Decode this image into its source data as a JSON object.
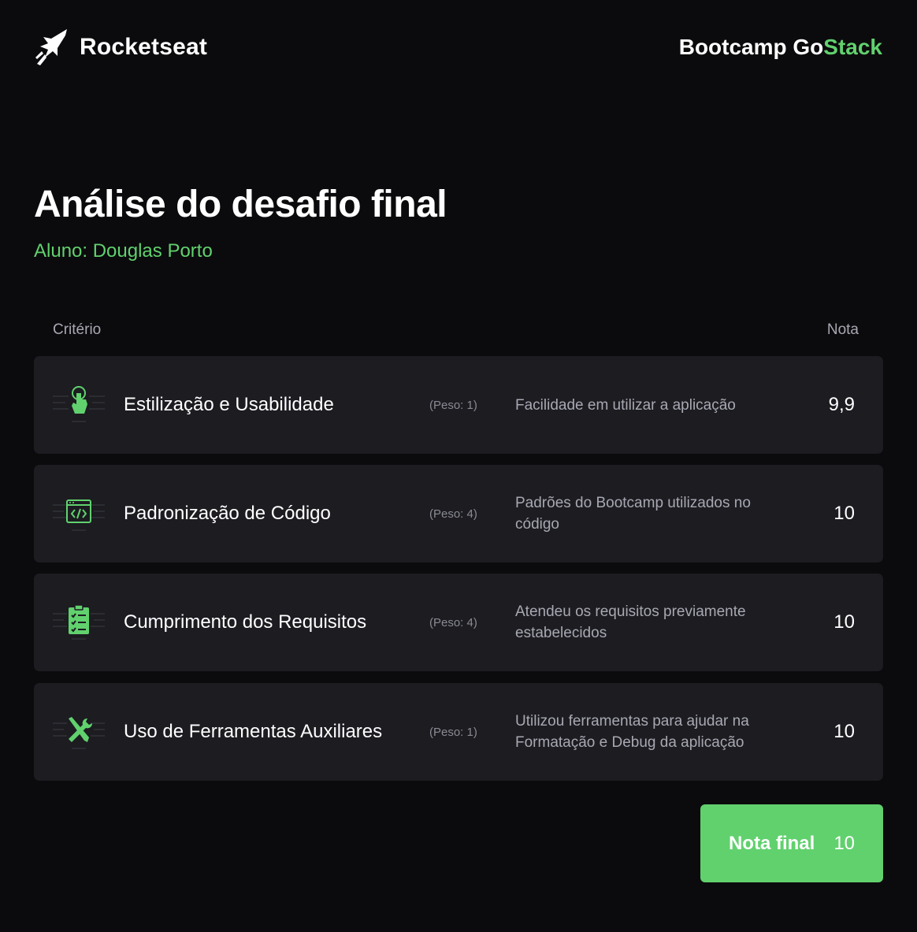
{
  "header": {
    "brand_name": "Rocketseat",
    "bootcamp_prefix": "Bootcamp Go",
    "bootcamp_accent": "Stack"
  },
  "title": "Análise do desafio final",
  "student": "Aluno: Douglas Porto",
  "table": {
    "col_criteria": "Critério",
    "col_grade": "Nota",
    "rows": [
      {
        "icon": "hand-pointer-icon",
        "name": "Estilização e Usabilidade",
        "weight": "(Peso: 1)",
        "description": "Facilidade em utilizar a aplicação",
        "grade": "9,9"
      },
      {
        "icon": "code-window-icon",
        "name": "Padronização de Código",
        "weight": "(Peso: 4)",
        "description": "Padrões do Bootcamp utilizados no código",
        "grade": "10"
      },
      {
        "icon": "clipboard-check-icon",
        "name": "Cumprimento dos Requisitos",
        "weight": "(Peso: 4)",
        "description": "Atendeu os requisitos previamente estabelecidos",
        "grade": "10"
      },
      {
        "icon": "tools-icon",
        "name": "Uso de Ferramentas Auxiliares",
        "weight": "(Peso: 1)",
        "description": "Utilizou ferramentas para ajudar na Formatação e Debug da aplicação",
        "grade": "10"
      }
    ]
  },
  "final": {
    "label": "Nota final",
    "value": "10"
  },
  "colors": {
    "background": "#0b0b0d",
    "card": "#1c1c21",
    "accent": "#61d16e",
    "muted": "#a8a8b3"
  }
}
